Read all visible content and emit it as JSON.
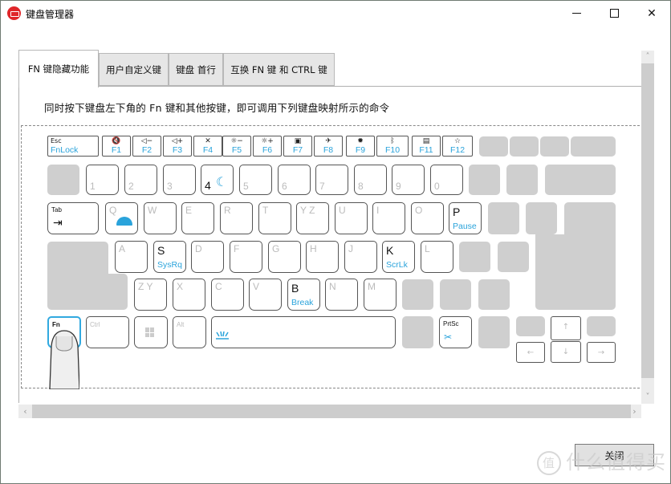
{
  "window": {
    "title": "键盘管理器",
    "app_icon": "keyboard-app-icon",
    "controls": {
      "minimize": "minimize-icon",
      "maximize": "maximize-icon",
      "close": "✕"
    }
  },
  "tabs": [
    {
      "label": "FN 键隐藏功能",
      "active": true
    },
    {
      "label": "用户自定义键",
      "active": false
    },
    {
      "label": "键盘 首行",
      "active": false
    },
    {
      "label": "互换 FN 键 和 CTRL 键",
      "active": false
    }
  ],
  "instruction": "同时按下键盘左下角的 Fn 键和其他按键，即可调用下列键盘映射所示的命令",
  "keyboard": {
    "esc": {
      "top": "Esc",
      "bottom": "FnLock"
    },
    "fkeys": [
      {
        "icon": "mute-icon",
        "glyph": "🔇",
        "label": "F1"
      },
      {
        "icon": "volume-down-icon",
        "glyph": "◁−",
        "label": "F2"
      },
      {
        "icon": "volume-up-icon",
        "glyph": "◁+",
        "label": "F3"
      },
      {
        "icon": "mic-mute-icon",
        "glyph": "✕",
        "label": "F4"
      },
      {
        "icon": "brightness-down-icon",
        "glyph": "☼−",
        "label": "F5"
      },
      {
        "icon": "brightness-up-icon",
        "glyph": "☼+",
        "label": "F6"
      },
      {
        "icon": "display-switch-icon",
        "glyph": "▣",
        "label": "F7"
      },
      {
        "icon": "airplane-mode-icon",
        "glyph": "✈",
        "label": "F8"
      },
      {
        "icon": "settings-icon",
        "glyph": "✹",
        "label": "F9"
      },
      {
        "icon": "bluetooth-icon",
        "glyph": "ᛒ",
        "label": "F10"
      },
      {
        "icon": "keyboard-icon",
        "glyph": "▤",
        "label": "F11"
      },
      {
        "icon": "favorite-star-icon",
        "glyph": "☆",
        "label": "F12"
      }
    ],
    "number_row": [
      "1",
      "2",
      "3",
      "4",
      "5",
      "6",
      "7",
      "8",
      "9",
      "0"
    ],
    "sleep_key": {
      "label": "4",
      "icon": "sleep-moon-icon"
    },
    "row_q": [
      "Q",
      "W",
      "E",
      "R",
      "T",
      "Y Z",
      "U",
      "I",
      "O",
      "P"
    ],
    "row_a": [
      "A",
      "S",
      "D",
      "F",
      "G",
      "H",
      "J",
      "K",
      "L"
    ],
    "row_z": [
      "Z Y",
      "X",
      "C",
      "V",
      "B",
      "N",
      "M"
    ],
    "tab": {
      "label": "Tab",
      "arrow": "⇥"
    },
    "special": {
      "Q": {
        "icon": "performance-mode-icon"
      },
      "P": {
        "sub": "Pause"
      },
      "S": {
        "sub": "SysRq"
      },
      "K": {
        "sub": "ScrLk"
      },
      "B": {
        "sub": "Break"
      }
    },
    "bottom_row": {
      "fn": "Fn",
      "ctrl": "Ctrl",
      "win": "windows-logo-icon",
      "alt": "Alt",
      "space": "backlight-icon",
      "prtsc": "PrtSc",
      "prtsc_icon": "snipping-tool-icon"
    },
    "arrows": {
      "up": "↑",
      "down": "↓",
      "left": "←",
      "right": "→"
    }
  },
  "scrollbars": {
    "up": "˄",
    "down": "˅",
    "left": "‹",
    "right": "›"
  },
  "footer": {
    "close_button": "关闭",
    "watermark": "什么值得买",
    "watermark_icon": "值"
  }
}
